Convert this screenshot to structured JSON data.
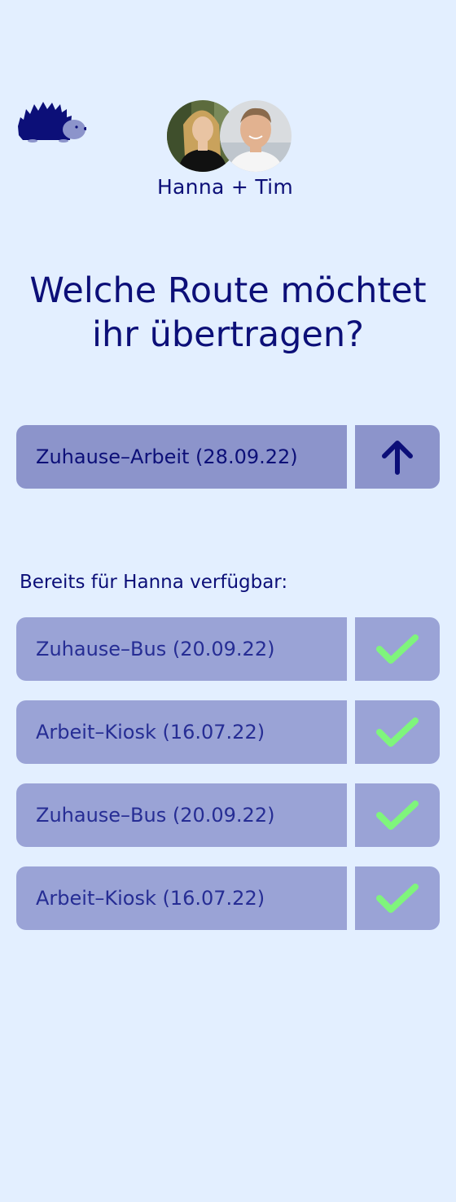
{
  "colors": {
    "background": "#e3efff",
    "text_dark": "#0c0f78",
    "primary_button": "#8c94cb",
    "list_item": "#9aa3d6",
    "check_green": "#7ff57c"
  },
  "header": {
    "logo_icon": "hedgehog-icon",
    "users_label": "Hanna + Tim"
  },
  "title": "Welche Route möchtet ihr übertragen?",
  "current_route": {
    "label": "Zuhause–Arbeit (28.09.22)",
    "action_icon": "arrow-up-icon"
  },
  "available": {
    "heading": "Bereits für Hanna verfügbar:",
    "items": [
      {
        "label": "Zuhause–Bus (20.09.22)",
        "icon": "check-icon"
      },
      {
        "label": "Arbeit–Kiosk (16.07.22)",
        "icon": "check-icon"
      },
      {
        "label": "Zuhause–Bus (20.09.22)",
        "icon": "check-icon"
      },
      {
        "label": "Arbeit–Kiosk (16.07.22)",
        "icon": "check-icon"
      }
    ]
  }
}
